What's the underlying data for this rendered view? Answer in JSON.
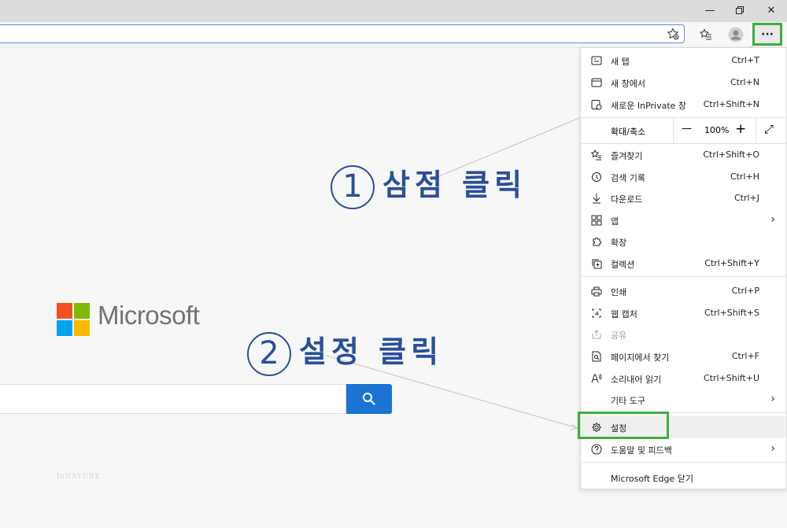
{
  "window": {
    "minimize_icon": "minimize-icon",
    "restore_icon": "restore-icon",
    "close_icon": "close-icon"
  },
  "toolbar": {
    "more_label": "···"
  },
  "brand": {
    "name": "Microsoft",
    "colors": [
      "#f25022",
      "#7fba00",
      "#00a4ef",
      "#ffb900"
    ],
    "search_color": "#1b73d4"
  },
  "watermark": "InNATURE",
  "annotations": {
    "step1_num": "1",
    "step1": "삼점 클릭",
    "step2_num": "2",
    "step2": "설정 클릭",
    "color": "#2a4f9a",
    "highlight_color": "#3ab03a"
  },
  "menu": {
    "items_top": [
      {
        "icon": "new-tab-icon",
        "label": "새 탭",
        "shortcut": "Ctrl+T"
      },
      {
        "icon": "new-window-icon",
        "label": "새 창에서",
        "shortcut": "Ctrl+N"
      },
      {
        "icon": "inprivate-icon",
        "label": "새로운 InPrivate 창",
        "shortcut": "Ctrl+Shift+N"
      }
    ],
    "zoom": {
      "label": "확대/축소",
      "minus": "—",
      "value": "100%",
      "plus": "+",
      "expand": "⤢"
    },
    "items_mid": [
      {
        "icon": "favorites-icon",
        "label": "즐겨찾기",
        "shortcut": "Ctrl+Shift+O"
      },
      {
        "icon": "history-icon",
        "label": "검색 기록",
        "shortcut": "Ctrl+H"
      },
      {
        "icon": "download-icon",
        "label": "다운로드",
        "shortcut": "Ctrl+J"
      },
      {
        "icon": "apps-icon",
        "label": "앱",
        "shortcut": ""
      },
      {
        "icon": "extensions-icon",
        "label": "확장",
        "shortcut": ""
      },
      {
        "icon": "collections-icon",
        "label": "컬렉션",
        "shortcut": "Ctrl+Shift+Y"
      }
    ],
    "items_low": [
      {
        "icon": "print-icon",
        "label": "인쇄",
        "shortcut": "Ctrl+P"
      },
      {
        "icon": "web-capture-icon",
        "label": "웹 캡처",
        "shortcut": "Ctrl+Shift+S"
      },
      {
        "icon": "share-icon",
        "label": "공유",
        "shortcut": ""
      },
      {
        "icon": "find-icon",
        "label": "페이지에서 찾기",
        "shortcut": "Ctrl+F"
      },
      {
        "icon": "read-aloud-icon",
        "label": "소리내어 읽기",
        "shortcut": "Ctrl+Shift+U"
      },
      {
        "icon": "",
        "label": "기타 도구",
        "shortcut": ""
      }
    ],
    "items_bottom": [
      {
        "icon": "settings-icon",
        "label": "설정",
        "shortcut": ""
      },
      {
        "icon": "help-icon",
        "label": "도움말 및 피드백",
        "shortcut": ""
      }
    ],
    "close_label": "Microsoft Edge 닫기"
  }
}
